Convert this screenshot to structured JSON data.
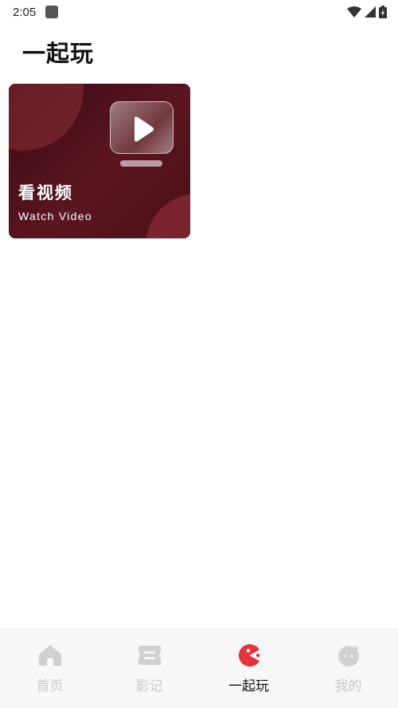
{
  "status_bar": {
    "time": "2:05"
  },
  "page": {
    "title": "一起玩"
  },
  "cards": [
    {
      "title_cn": "看视频",
      "title_en": "Watch Video",
      "icon": "tv-play-icon"
    }
  ],
  "bottom_nav": {
    "items": [
      {
        "label": "首页",
        "icon": "home-icon",
        "active": false
      },
      {
        "label": "影记",
        "icon": "ticket-icon",
        "active": false
      },
      {
        "label": "一起玩",
        "icon": "pacman-icon",
        "active": true
      },
      {
        "label": "我的",
        "icon": "face-icon",
        "active": false
      }
    ],
    "active_color": "#e8323c",
    "inactive_color": "#d0d0d0"
  },
  "colors": {
    "card_bg": "#4b1018",
    "accent": "#e8323c"
  }
}
